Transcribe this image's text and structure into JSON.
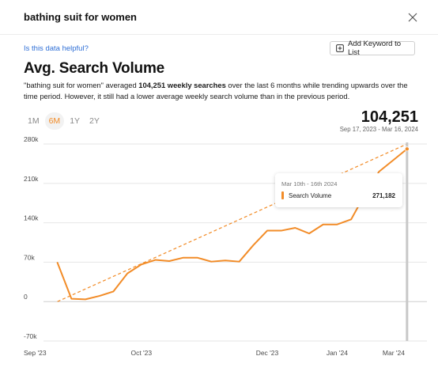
{
  "header": {
    "title": "bathing suit for women",
    "close_icon": "close-icon"
  },
  "helpful_link": "Is this data helpful?",
  "add_keyword_button": {
    "label": "Add Keyword to List",
    "icon": "plus-square-icon"
  },
  "section_title": "Avg. Search Volume",
  "summary": {
    "part1": "\"bathing suit for women\" averaged ",
    "bold": "104,251 weekly searches",
    "part2": " over the last 6 months while trending upwards over the time period. However, it still had a lower average weekly search volume than in the previous period."
  },
  "range_tabs": [
    {
      "label": "1M",
      "active": false
    },
    {
      "label": "6M",
      "active": true
    },
    {
      "label": "1Y",
      "active": false
    },
    {
      "label": "2Y",
      "active": false
    }
  ],
  "big_value": "104,251",
  "date_range": "Sep 17, 2023 - Mar 16, 2024",
  "tooltip": {
    "date": "Mar 10th - 16th 2024",
    "label": "Search Volume",
    "value": "271,182"
  },
  "colors": {
    "accent": "#f28c28",
    "gridline": "#e6e6e6",
    "zero_line": "#cfcfcf",
    "hover_line": "#c8c8c8"
  },
  "chart_data": {
    "type": "line",
    "series": [
      {
        "name": "Search Volume",
        "x": [
          "2023-09-17",
          "2023-09-24",
          "2023-10-01",
          "2023-10-08",
          "2023-10-15",
          "2023-10-22",
          "2023-10-29",
          "2023-11-05",
          "2023-11-12",
          "2023-11-19",
          "2023-11-26",
          "2023-12-03",
          "2023-12-10",
          "2023-12-17",
          "2023-12-24",
          "2023-12-31",
          "2024-01-07",
          "2024-01-14",
          "2024-01-21",
          "2024-01-28",
          "2024-02-04",
          "2024-02-11",
          "2024-02-18",
          "2024-02-25",
          "2024-03-03",
          "2024-03-10"
        ],
        "values": [
          69000,
          5000,
          4000,
          10000,
          18000,
          50000,
          66000,
          74000,
          72000,
          78000,
          78000,
          71000,
          73000,
          71000,
          100000,
          126000,
          126000,
          131000,
          121000,
          137000,
          137000,
          146000,
          191000,
          231000,
          251000,
          271182
        ]
      }
    ],
    "trendline": {
      "x": [
        "2023-09-17",
        "2024-03-10"
      ],
      "values": [
        0,
        280000
      ]
    },
    "x_ticks": [
      "Sep '23",
      "Oct '23",
      "Dec '23",
      "Jan '24",
      "Mar '24"
    ],
    "x_tick_dates": [
      "2023-09-17",
      "2023-10-29",
      "2023-12-31",
      "2024-02-04",
      "2024-03-17"
    ],
    "y_ticks": [
      -70000,
      0,
      70000,
      140000,
      210000,
      280000
    ],
    "y_tick_labels": [
      "-70k",
      "0",
      "70k",
      "140k",
      "210k",
      "280k"
    ],
    "ylim": [
      -70000,
      280000
    ],
    "grid": "horizontal"
  }
}
